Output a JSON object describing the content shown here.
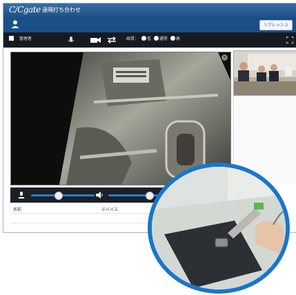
{
  "app": {
    "logo": "C/Cgate",
    "title": "遠隔打ち合わせ"
  },
  "userbar": {
    "refresh_label": "リフレッシュ"
  },
  "toolbar": {
    "admin_label": "管理者",
    "quality_label": "画質：",
    "quality_options": [
      "低",
      "通常",
      "高"
    ]
  },
  "table": {
    "columns": [
      "名前",
      "デバイス"
    ]
  },
  "colors": {
    "title_bar": "#1f4f86",
    "toolbar": "#161b21",
    "accent": "#2a7ed0",
    "inset_border": "#1976cc"
  }
}
